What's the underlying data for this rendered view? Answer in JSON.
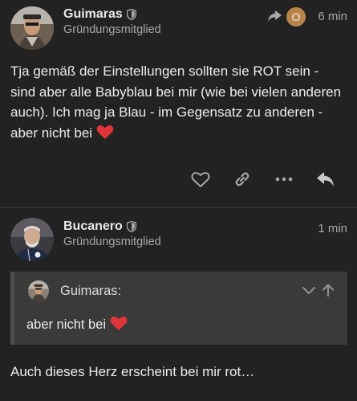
{
  "posts": [
    {
      "username": "Guimaras",
      "user_title": "Gründungsmitglied",
      "time": "6 min",
      "reply_to_initial": "O",
      "body": "Tja gemäß der Einstellungen sollten sie ROT sein - sind aber alle Babyblau bei mir (wie bei vielen anderen auch). Ich mag ja Blau - im Gegensatz zu anderen - aber nicht bei"
    },
    {
      "username": "Bucanero",
      "user_title": "Gründungsmitglied",
      "time": "1 min",
      "quote": {
        "username": "Guimaras:",
        "text": "aber nicht bei"
      },
      "body": "Auch dieses Herz erscheint bei mir rot…"
    }
  ],
  "icons": {
    "like": "heart-outline-icon",
    "link": "link-icon",
    "more": "ellipsis-icon",
    "reply": "reply-icon",
    "expand": "chevron-down-icon",
    "go_to_quote": "arrow-up-icon"
  },
  "colors": {
    "background": "#222222",
    "heart": "#e0343b",
    "reply_avatar": "#b8844a",
    "quote_background": "#3a3a3a"
  }
}
